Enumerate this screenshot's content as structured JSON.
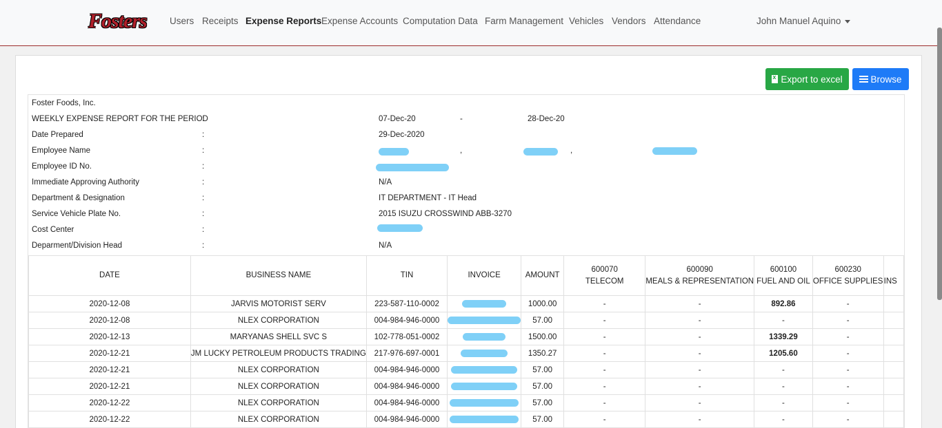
{
  "nav": {
    "logo_text": "Fosters",
    "items": [
      "Users",
      "Receipts",
      "Expense Reports",
      "Expense Accounts",
      "Computation Data",
      "Farm Management",
      "Vehicles",
      "Vendors",
      "Attendance"
    ],
    "user": "John Manuel Aquino"
  },
  "actions": {
    "export_label": "Export to excel",
    "browse_label": "Browse"
  },
  "report": {
    "company": "Foster Foods, Inc.",
    "rows": [
      {
        "label": "WEEKLY EXPENSE REPORT FOR THE PERIOD",
        "colon": ":",
        "value": "07-Dec-20",
        "dash": "-",
        "value2": "28-Dec-20"
      },
      {
        "label": "Date Prepared",
        "colon": ":",
        "value": "29-Dec-2020"
      },
      {
        "label": "Employee Name",
        "colon": ":",
        "value": "",
        "sep1": ",",
        "sep2": ","
      },
      {
        "label": "Employee ID No.",
        "colon": ":",
        "value": ""
      },
      {
        "label": "Immediate Approving Authority",
        "colon": ":",
        "value": "N/A"
      },
      {
        "label": "Department & Designation",
        "colon": ":",
        "value": "IT DEPARTMENT - IT Head"
      },
      {
        "label": "Service Vehicle Plate No.",
        "colon": ":",
        "value": "2015 ISUZU CROSSWIND ABB-3270"
      },
      {
        "label": "Cost Center",
        "colon": ":",
        "value": ""
      },
      {
        "label": "Deparment/Division Head",
        "colon": ":",
        "value": "N/A"
      }
    ]
  },
  "table": {
    "headers": [
      {
        "code": "",
        "name": "DATE"
      },
      {
        "code": "",
        "name": "BUSINESS NAME"
      },
      {
        "code": "",
        "name": "TIN"
      },
      {
        "code": "",
        "name": "INVOICE"
      },
      {
        "code": "",
        "name": "AMOUNT"
      },
      {
        "code": "600070",
        "name": "TELECOM"
      },
      {
        "code": "600090",
        "name": "MEALS & REPRESENTATION"
      },
      {
        "code": "600100",
        "name": "FUEL AND OIL"
      },
      {
        "code": "600230",
        "name": "OFFICE SUPPLIES"
      },
      {
        "code": "",
        "name": "INS"
      }
    ],
    "rows": [
      {
        "date": "2020-12-08",
        "business": "JARVIS MOTORIST SERV",
        "tin": "223-587-110-0002",
        "invoice": "",
        "amount": "1000.00",
        "telecom": "-",
        "meals": "-",
        "fuel": "892.86",
        "office": "-"
      },
      {
        "date": "2020-12-08",
        "business": "NLEX CORPORATION",
        "tin": "004-984-946-0000",
        "invoice": "",
        "amount": "57.00",
        "telecom": "-",
        "meals": "-",
        "fuel": "-",
        "office": "-"
      },
      {
        "date": "2020-12-13",
        "business": "MARYANAS SHELL SVC S",
        "tin": "102-778-051-0002",
        "invoice": "",
        "amount": "1500.00",
        "telecom": "-",
        "meals": "-",
        "fuel": "1339.29",
        "office": "-"
      },
      {
        "date": "2020-12-21",
        "business": "JM LUCKY PETROLEUM PRODUCTS TRADING",
        "tin": "217-976-697-0001",
        "invoice": "",
        "amount": "1350.27",
        "telecom": "-",
        "meals": "-",
        "fuel": "1205.60",
        "office": "-"
      },
      {
        "date": "2020-12-21",
        "business": "NLEX CORPORATION",
        "tin": "004-984-946-0000",
        "invoice": "",
        "amount": "57.00",
        "telecom": "-",
        "meals": "-",
        "fuel": "-",
        "office": "-"
      },
      {
        "date": "2020-12-21",
        "business": "NLEX CORPORATION",
        "tin": "004-984-946-0000",
        "invoice": "",
        "amount": "57.00",
        "telecom": "-",
        "meals": "-",
        "fuel": "-",
        "office": "-"
      },
      {
        "date": "2020-12-22",
        "business": "NLEX CORPORATION",
        "tin": "004-984-946-0000",
        "invoice": "",
        "amount": "57.00",
        "telecom": "-",
        "meals": "-",
        "fuel": "-",
        "office": "-"
      },
      {
        "date": "2020-12-22",
        "business": "NLEX CORPORATION",
        "tin": "004-984-946-0000",
        "invoice": "",
        "amount": "57.00",
        "telecom": "-",
        "meals": "-",
        "fuel": "-",
        "office": "-"
      }
    ]
  },
  "colors": {
    "accent_red": "#b0202a",
    "excel_green": "#28a745",
    "browse_blue": "#1e7bf7",
    "redaction": "#7fd0f7"
  }
}
